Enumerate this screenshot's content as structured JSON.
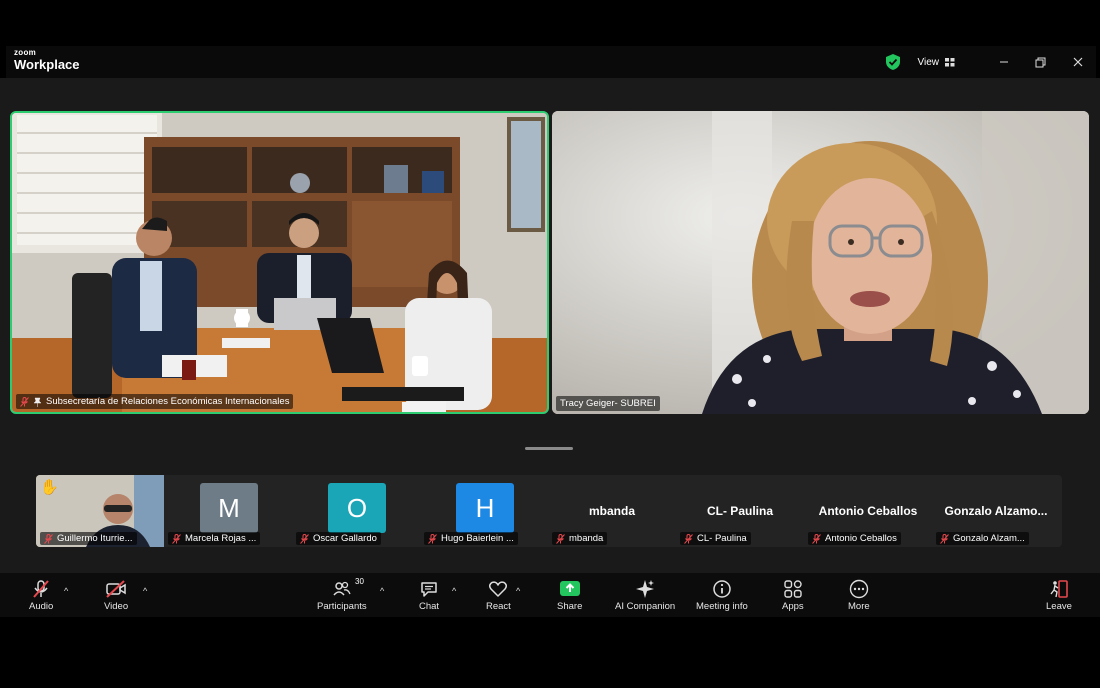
{
  "app": {
    "logo_top": "zoom",
    "logo_bottom": "Workplace"
  },
  "titlebar": {
    "view_label": "View"
  },
  "video_tiles": [
    {
      "name": "Subsecretaría de Relaciones Económicas Internacionales"
    },
    {
      "name": "Tracy Geiger- SUBREI"
    }
  ],
  "participants_strip": [
    {
      "name": "Guillermo Iturrie...",
      "display": "",
      "kind": "video"
    },
    {
      "name": "Marcela Rojas ...",
      "display": "M",
      "kind": "letter",
      "color": "#6e7c88"
    },
    {
      "name": "Oscar Gallardo",
      "display": "O",
      "kind": "letter",
      "color": "#1aa6b7"
    },
    {
      "name": "Hugo Baierlein ...",
      "display": "H",
      "kind": "letter",
      "color": "#1e88e5"
    },
    {
      "name": "mbanda",
      "display": "mbanda",
      "kind": "text"
    },
    {
      "name": "CL- Paulina",
      "display": "CL- Paulina",
      "kind": "text"
    },
    {
      "name": "Antonio Ceballos",
      "display": "Antonio Ceballos",
      "kind": "text"
    },
    {
      "name": "Gonzalo Alzam...",
      "display": "Gonzalo Alzamo...",
      "kind": "text"
    }
  ],
  "toolbar": {
    "audio": "Audio",
    "video": "Video",
    "participants": "Participants",
    "participants_count": "30",
    "chat": "Chat",
    "react": "React",
    "share": "Share",
    "ai_companion": "AI Companion",
    "meeting_info": "Meeting info",
    "apps": "Apps",
    "more": "More",
    "leave": "Leave"
  },
  "colors": {
    "active_speaker_border": "#2ecc71",
    "share_green": "#22c55e",
    "muted_red": "#e5484d"
  }
}
